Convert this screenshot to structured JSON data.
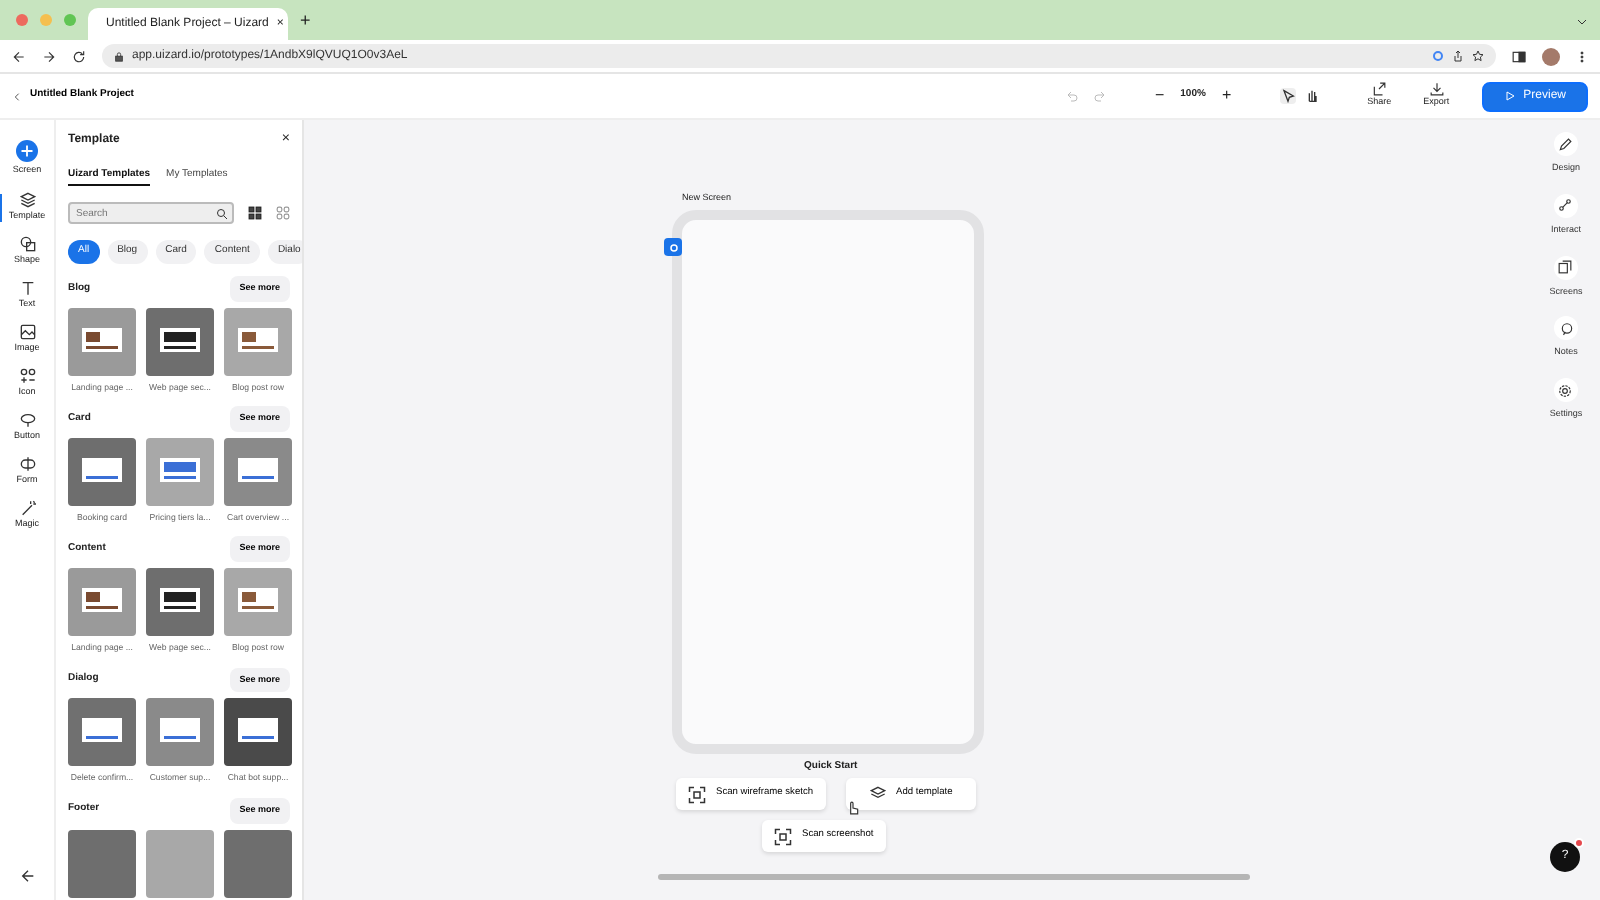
{
  "browser": {
    "tab_title": "Untitled Blank Project – Uizard",
    "new_tab": "+",
    "close_tab": "×",
    "url": "app.uizard.io/prototypes/1AndbX9lQVUQ1O0v3AeL"
  },
  "header": {
    "project_title": "Untitled Blank Project",
    "zoom": "100%",
    "zoom_out": "−",
    "zoom_in": "+",
    "share": "Share",
    "export": "Export",
    "preview": "Preview"
  },
  "left_rail": [
    {
      "label": "Screen",
      "kind": "add",
      "selected": false
    },
    {
      "label": "Template",
      "kind": "template",
      "selected": true
    },
    {
      "label": "Shape",
      "kind": "shape",
      "selected": false
    },
    {
      "label": "Text",
      "kind": "text",
      "selected": false
    },
    {
      "label": "Image",
      "kind": "image",
      "selected": false
    },
    {
      "label": "Icon",
      "kind": "icon",
      "selected": false
    },
    {
      "label": "Button",
      "kind": "button",
      "selected": false
    },
    {
      "label": "Form",
      "kind": "form",
      "selected": false
    },
    {
      "label": "Magic",
      "kind": "magic",
      "selected": false
    }
  ],
  "panel": {
    "title": "Template",
    "close": "×",
    "tabs": [
      {
        "label": "Uizard Templates",
        "selected": true
      },
      {
        "label": "My Templates",
        "selected": false
      }
    ],
    "search": {
      "placeholder": "Search"
    },
    "view": [
      {
        "kind": "grid-large",
        "selected": true
      },
      {
        "kind": "grid-small",
        "selected": false
      }
    ],
    "filters": [
      {
        "label": "All",
        "selected": true
      },
      {
        "label": "Blog",
        "selected": false
      },
      {
        "label": "Card",
        "selected": false
      },
      {
        "label": "Content",
        "selected": false
      },
      {
        "label": "Dialo",
        "selected": false
      }
    ],
    "sections": [
      {
        "title": "Blog",
        "see_more": "See more",
        "items": [
          {
            "caption": "Landing page ...",
            "kind": "landing"
          },
          {
            "caption": "Web page sec...",
            "kind": "web"
          },
          {
            "caption": "Blog post row",
            "kind": "blog"
          }
        ]
      },
      {
        "title": "Card",
        "see_more": "See more",
        "items": [
          {
            "caption": "Booking card",
            "kind": "booking"
          },
          {
            "caption": "Pricing tiers la...",
            "kind": "pricing"
          },
          {
            "caption": "Cart overview ...",
            "kind": "cart"
          }
        ]
      },
      {
        "title": "Content",
        "see_more": "See more",
        "items": [
          {
            "caption": "Landing page ...",
            "kind": "landing"
          },
          {
            "caption": "Web page sec...",
            "kind": "web"
          },
          {
            "caption": "Blog post row",
            "kind": "blog"
          }
        ]
      },
      {
        "title": "Dialog",
        "see_more": "See more",
        "items": [
          {
            "caption": "Delete confirm...",
            "kind": "delete"
          },
          {
            "caption": "Customer sup...",
            "kind": "support"
          },
          {
            "caption": "Chat bot supp...",
            "kind": "chat"
          }
        ]
      },
      {
        "title": "Footer",
        "see_more": "See more",
        "items": [
          {
            "kind": "plain"
          },
          {
            "kind": "plain-light"
          },
          {
            "kind": "plain"
          }
        ]
      }
    ]
  },
  "canvas": {
    "screen_label": "New Screen",
    "quick_start": {
      "title": "Quick Start",
      "buttons": [
        {
          "label": "Scan wireframe sketch",
          "kind": "scan"
        },
        {
          "label": "Add template",
          "kind": "template"
        },
        {
          "label": "Scan screenshot",
          "kind": "scan"
        }
      ]
    }
  },
  "right_rail": [
    {
      "label": "Design",
      "kind": "design"
    },
    {
      "label": "Interact",
      "kind": "interact"
    },
    {
      "label": "Screens",
      "kind": "screens"
    },
    {
      "label": "Notes",
      "kind": "notes"
    },
    {
      "label": "Settings",
      "kind": "settings"
    }
  ],
  "help": {
    "label": "?"
  }
}
